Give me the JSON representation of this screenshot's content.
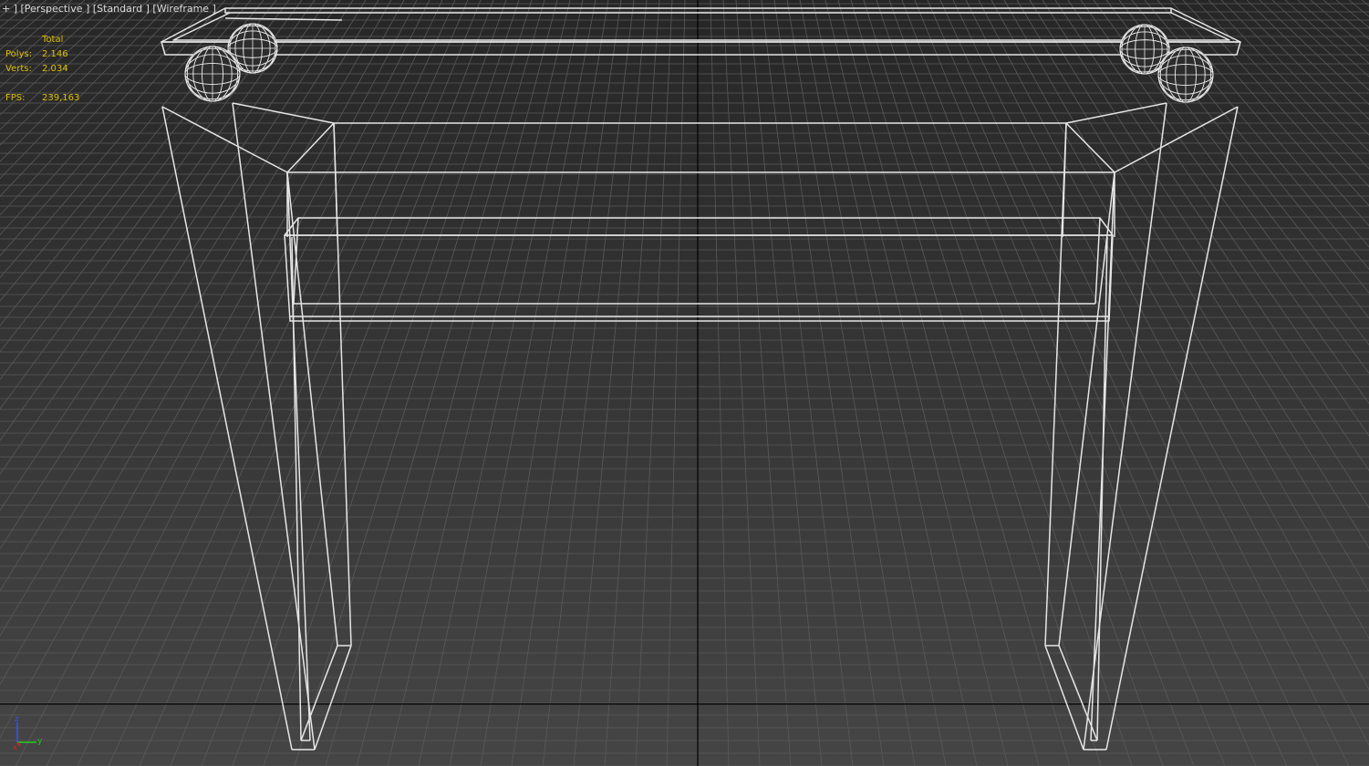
{
  "viewport": {
    "menu_plus": "+",
    "view_mode": "Perspective",
    "shading": "Standard",
    "display_style": "Wireframe"
  },
  "stats": {
    "header": "Total",
    "polys_label": "Polys:",
    "polys_value": "2.146",
    "verts_label": "Verts:",
    "verts_value": "2.034",
    "fps_label": "FPS:",
    "fps_value": "239,163"
  },
  "gizmo": {
    "z_label": "z",
    "y_label": "y",
    "x_label": "x",
    "z_color": "#3355ff",
    "y_color": "#22cc22",
    "x_color": "#dd2222"
  },
  "colors": {
    "wire": "#e6e6e6",
    "grid": "#5a5a5a",
    "grid_axis": "#000000",
    "stats_text": "#e0c000"
  }
}
